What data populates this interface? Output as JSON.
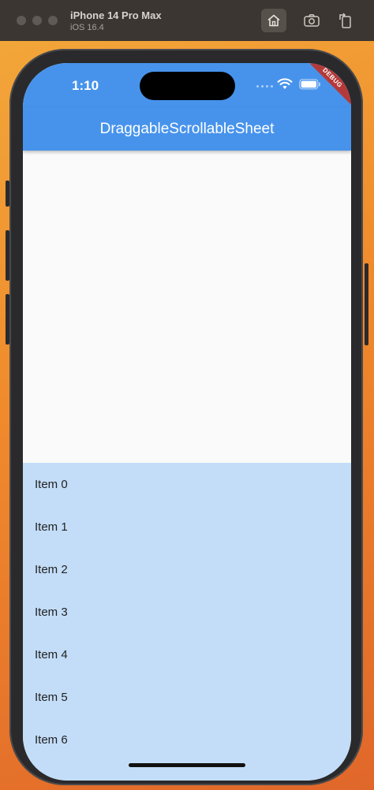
{
  "simulator": {
    "device_name": "iPhone 14 Pro Max",
    "os_version": "iOS 16.4"
  },
  "status_bar": {
    "time": "1:10"
  },
  "debug_banner": "DEBUG",
  "app_bar": {
    "title": "DraggableScrollableSheet",
    "color": "#4793ec"
  },
  "sheet": {
    "color": "#c3ddf8",
    "items": [
      "Item 0",
      "Item 1",
      "Item 2",
      "Item 3",
      "Item 4",
      "Item 5",
      "Item 6"
    ]
  },
  "icons": {
    "home": "home-icon",
    "screenshot": "camera-icon",
    "rotate": "rotate-icon",
    "wifi": "wifi-icon",
    "battery": "battery-icon"
  }
}
